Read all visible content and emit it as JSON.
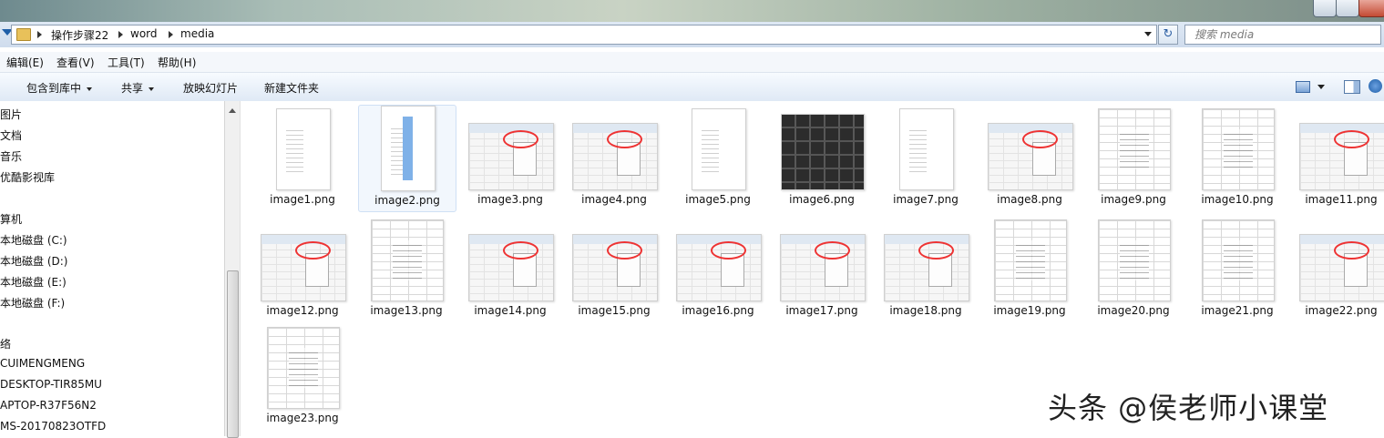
{
  "address": {
    "breadcrumbs": [
      "操作步骤22",
      "word",
      "media"
    ],
    "search_placeholder": "搜索 media"
  },
  "menu": [
    "编辑(E)",
    "查看(V)",
    "工具(T)",
    "帮助(H)"
  ],
  "toolbar": {
    "include_library": "包含到库中",
    "share": "共享",
    "slideshow": "放映幻灯片",
    "new_folder": "新建文件夹"
  },
  "sidebar": {
    "items": [
      "图片",
      "文档",
      "音乐",
      "优酷影视库",
      "算机",
      "本地磁盘 (C:)",
      "本地磁盘 (D:)",
      "本地磁盘 (E:)",
      "本地磁盘 (F:)",
      "络",
      "CUIMENGMENG",
      "DESKTOP-TIR85MU",
      "APTOP-R37F56N2",
      "MS-20170823OTFD"
    ]
  },
  "files": [
    {
      "name": "image1.png",
      "kind": "doc"
    },
    {
      "name": "image2.png",
      "kind": "doc-selected"
    },
    {
      "name": "image3.png",
      "kind": "screenshot"
    },
    {
      "name": "image4.png",
      "kind": "screenshot"
    },
    {
      "name": "image5.png",
      "kind": "doc"
    },
    {
      "name": "image6.png",
      "kind": "keyboard-photo"
    },
    {
      "name": "image7.png",
      "kind": "doc"
    },
    {
      "name": "image8.png",
      "kind": "screenshot"
    },
    {
      "name": "image9.png",
      "kind": "table"
    },
    {
      "name": "image10.png",
      "kind": "table"
    },
    {
      "name": "image11.png",
      "kind": "screenshot"
    },
    {
      "name": "image12.png",
      "kind": "screenshot"
    },
    {
      "name": "image13.png",
      "kind": "table"
    },
    {
      "name": "image14.png",
      "kind": "screenshot"
    },
    {
      "name": "image15.png",
      "kind": "screenshot"
    },
    {
      "name": "image16.png",
      "kind": "screenshot"
    },
    {
      "name": "image17.png",
      "kind": "screenshot"
    },
    {
      "name": "image18.png",
      "kind": "screenshot"
    },
    {
      "name": "image19.png",
      "kind": "table"
    },
    {
      "name": "image20.png",
      "kind": "table"
    },
    {
      "name": "image21.png",
      "kind": "table"
    },
    {
      "name": "image22.png",
      "kind": "screenshot"
    },
    {
      "name": "image23.png",
      "kind": "table"
    }
  ],
  "selected_file": "image2.png",
  "watermark": "头条 @侯老师小课堂"
}
